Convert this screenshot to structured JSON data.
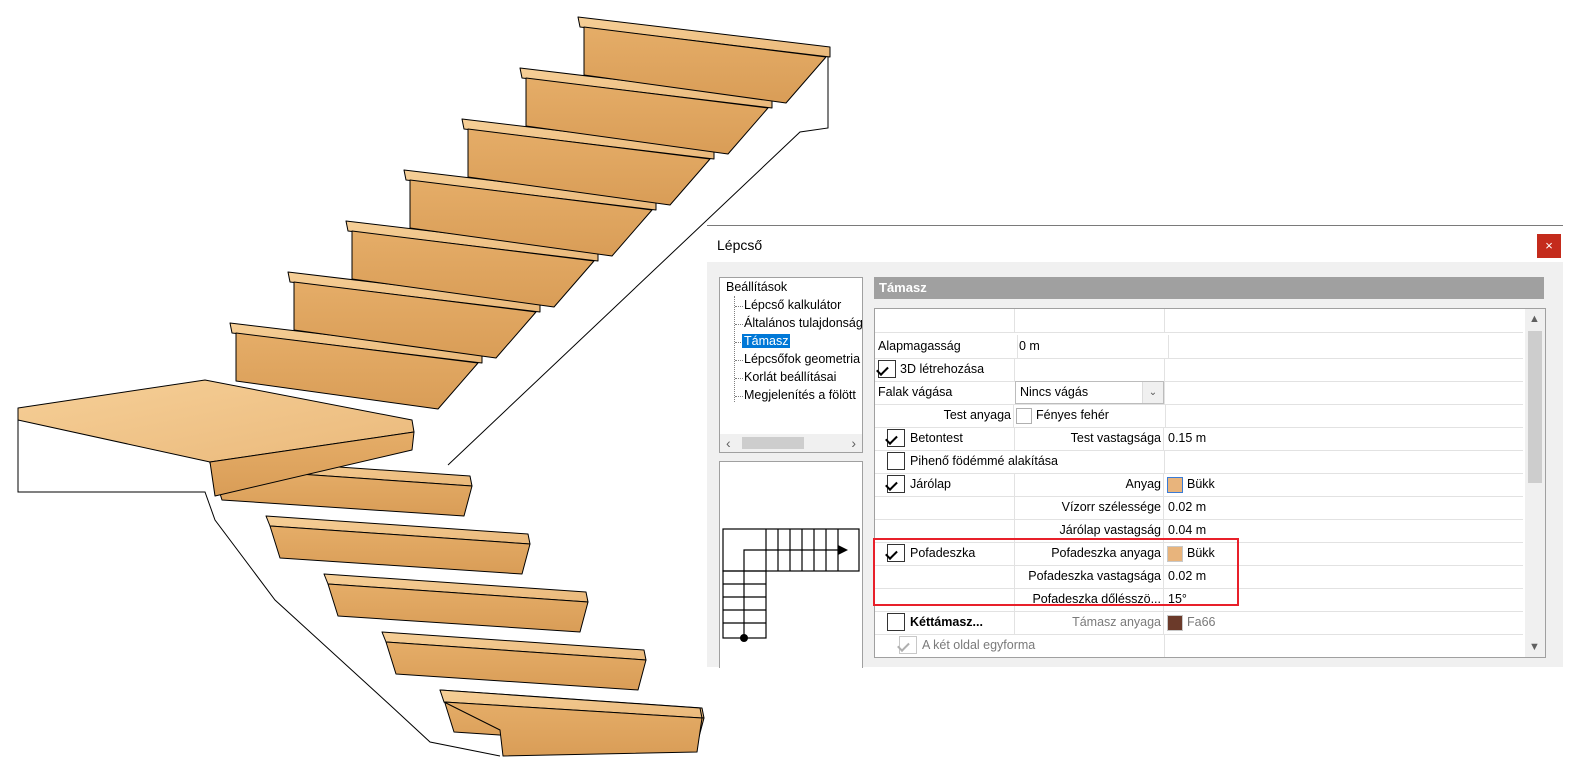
{
  "dialog": {
    "title": "Lépcső",
    "close_icon": "×"
  },
  "tree": {
    "items": [
      {
        "label": "Beállítások"
      },
      {
        "label": "Lépcső kalkulátor"
      },
      {
        "label": "Általános tulajdonságok"
      },
      {
        "label": "Támasz",
        "selected": true
      },
      {
        "label": "Lépcsőfok geometria"
      },
      {
        "label": "Korlát beállításai"
      },
      {
        "label": "Megjelenítés a fölött"
      }
    ],
    "scroll_left": "‹",
    "scroll_right": "›"
  },
  "section": {
    "title": "Támasz"
  },
  "grid": {
    "rows": [
      {
        "c1": "Alapmagasság",
        "c2": "0 m"
      },
      {
        "check": true,
        "c1": "3D létrehozása"
      },
      {
        "c1": "Falak vágása",
        "combo": "Nincs vágás"
      },
      {
        "c1": "Test anyaga",
        "material": "Fényes fehér",
        "material_color": "#ffffff"
      },
      {
        "check": true,
        "c1": "Betontest",
        "c2": "Test vastagsága",
        "c3": "0.15 m"
      },
      {
        "check": false,
        "c1": "Pihenő födémmé alakítása"
      },
      {
        "check": true,
        "c1": "Járólap",
        "c2": "Anyag",
        "material": "Bükk",
        "material_color": "#e8b47c"
      },
      {
        "c2": "Vízorr szélessége",
        "c3": "0.02 m"
      },
      {
        "c2": "Járólap vastagság",
        "c3": "0.04 m"
      },
      {
        "check": true,
        "c1": "Pofadeszka",
        "c2": "Pofadeszka anyaga",
        "material": "Bükk",
        "material_color": "#e8b47c"
      },
      {
        "c2": "Pofadeszka vastagsága",
        "c3": "0.02 m"
      },
      {
        "c2": "Pofadeszka dőlésszö...",
        "c3": "15°"
      },
      {
        "check": false,
        "c1": "Kéttámasz...",
        "c2": "Támasz anyaga",
        "material": "Fa66",
        "material_color": "#6b3a2a"
      },
      {
        "check": true,
        "disabled": true,
        "c1": "A két oldal egyforma"
      }
    ],
    "scroll_up": "▲",
    "scroll_down": "▼",
    "combo_arrow": "⌄"
  },
  "colors": {
    "close_button": "#c42b1c",
    "selection": "#0078d7",
    "highlight": "#e8202a",
    "wood_light": "#f3c68a",
    "wood_dark": "#d9a35f"
  }
}
